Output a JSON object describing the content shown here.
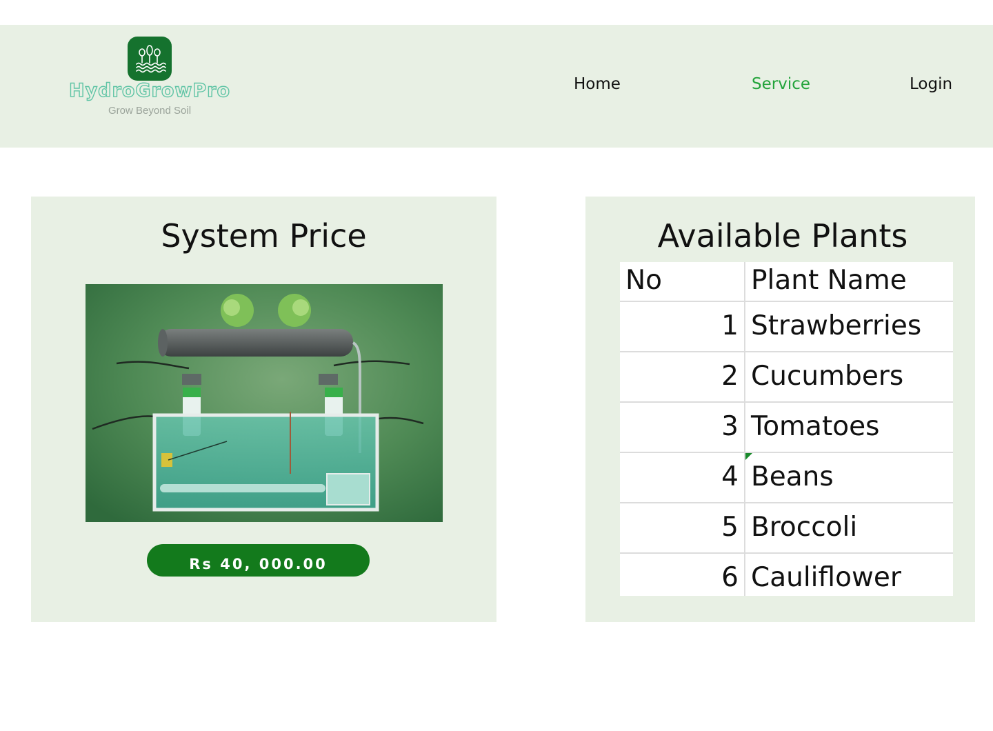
{
  "brand": {
    "name": "HydroGrowPro",
    "tagline": "Grow Beyond Soil",
    "logo_icon": "plants-water-logo-icon"
  },
  "nav": {
    "items": [
      {
        "label": "Home",
        "active": false
      },
      {
        "label": "Service",
        "active": true
      },
      {
        "label": "Login",
        "active": false
      }
    ]
  },
  "price_card": {
    "title": "System Price",
    "image": "hydroponic-system-image",
    "price_label": "Rs 40, 000.00"
  },
  "plants_card": {
    "title": "Available Plants",
    "columns": [
      "No",
      "Plant Name"
    ],
    "rows": [
      {
        "no": "1",
        "name": "Strawberries"
      },
      {
        "no": "2",
        "name": "Cucumbers"
      },
      {
        "no": "3",
        "name": "Tomatoes"
      },
      {
        "no": "4",
        "name": "Beans"
      },
      {
        "no": "5",
        "name": "Broccoli"
      },
      {
        "no": "6",
        "name": "Cauliflower"
      }
    ]
  },
  "colors": {
    "header_bg": "#e8f0e4",
    "card_bg": "#e8f0e4",
    "accent": "#22a33a",
    "button_bg": "#137a1c",
    "logo_badge": "#15722e"
  }
}
